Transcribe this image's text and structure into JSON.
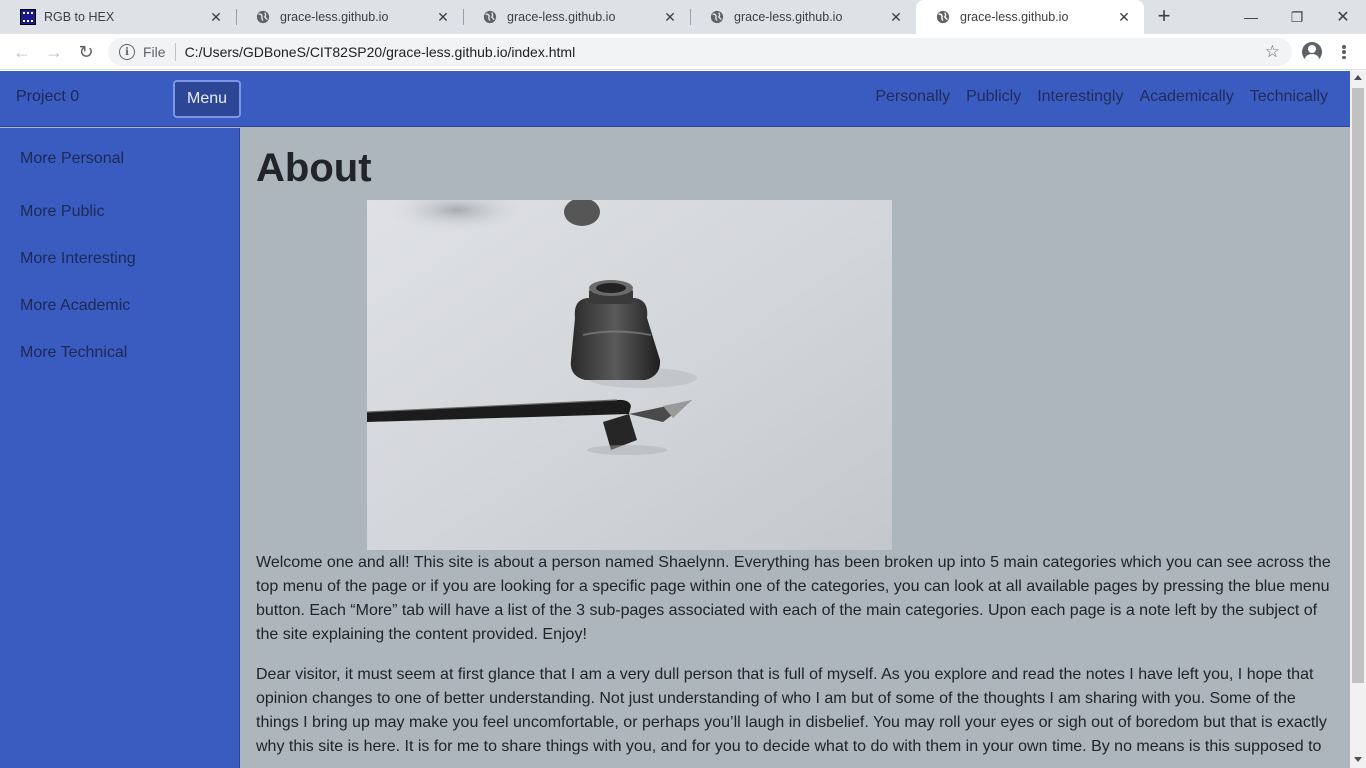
{
  "browser": {
    "tabs": [
      {
        "title": "RGB to HEX",
        "icon": "rgb-favicon",
        "active": false
      },
      {
        "title": "grace-less.github.io",
        "icon": "globe-icon",
        "active": false
      },
      {
        "title": "grace-less.github.io",
        "icon": "globe-icon",
        "active": false
      },
      {
        "title": "grace-less.github.io",
        "icon": "globe-icon",
        "active": false
      },
      {
        "title": "grace-less.github.io",
        "icon": "globe-icon",
        "active": true
      }
    ],
    "close_glyph": "✕",
    "new_tab_glyph": "+",
    "window_controls": {
      "minimize": "—",
      "restore": "❐",
      "close": "✕"
    },
    "nav": {
      "back": "←",
      "forward": "→",
      "reload": "↻"
    },
    "omnibox": {
      "info_glyph": "i",
      "scheme_label": "File",
      "url": "C:/Users/GDBoneS/CIT82SP20/grace-less.github.io/index.html",
      "star_glyph": "☆"
    }
  },
  "page": {
    "colors": {
      "navbar": "#3a5bbf",
      "background": "#adb5bd",
      "menu_button": "#2d4796"
    },
    "navbar": {
      "brand": "Project 0",
      "menu_button": "Menu",
      "links": [
        "Personally",
        "Publicly",
        "Interestingly",
        "Academically",
        "Technically"
      ]
    },
    "sidebar": {
      "items": [
        "More Personal",
        "More Public",
        "More Interesting",
        "More Academic",
        "More Technical"
      ]
    },
    "main": {
      "heading": "About",
      "image_subject": "ink bottle and dip pen on white surface",
      "paragraphs": [
        "Welcome one and all! This site is about a person named Shaelynn. Everything has been broken up into 5 main categories which you can see across the top menu of the page or if you are looking for a specific page within one of the categories, you can look at all available pages by pressing the blue menu button. Each “More” tab will have a list of the 3 sub-pages associated with each of the main categories. Upon each page is a note left by the subject of the site explaining the content provided. Enjoy!",
        "Dear visitor, it must seem at first glance that I am a very dull person that is full of myself. As you explore and read the notes I have left you, I hope that opinion changes to one of better understanding. Not just understanding of who I am but of some of the thoughts I am sharing with you. Some of the things I bring up may make you feel uncomfortable, or perhaps you’ll laugh in disbelief. You may roll your eyes or sigh out of boredom but that is exactly why this site is here. It is for me to share things with you, and for you to decide what to do with them in your own time. By no means is this supposed to"
      ]
    }
  }
}
